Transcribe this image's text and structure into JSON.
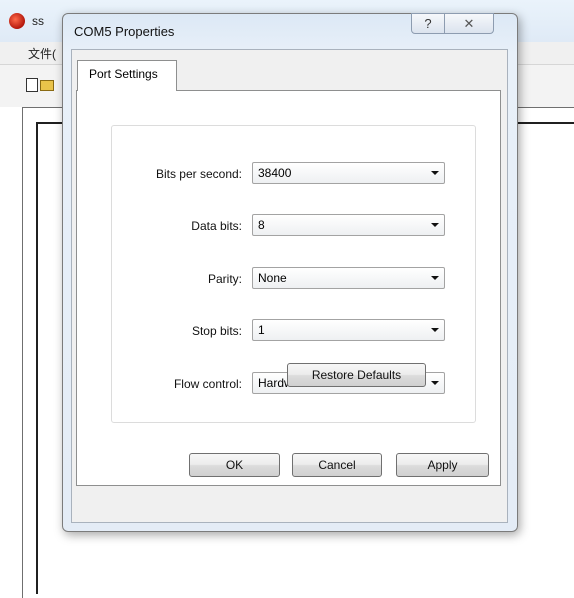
{
  "background_app": {
    "title": "ss",
    "menu_file": "文件("
  },
  "dialog": {
    "title": "COM5 Properties",
    "help_glyph": "?",
    "close_glyph": "✕",
    "tab_label": "Port Settings",
    "fields": [
      {
        "label": "Bits per second:",
        "value": "38400"
      },
      {
        "label": "Data bits:",
        "value": "8"
      },
      {
        "label": "Parity:",
        "value": "None"
      },
      {
        "label": "Stop bits:",
        "value": "1"
      },
      {
        "label": "Flow control:",
        "value": "Hardware"
      }
    ],
    "restore_defaults_label": "Restore Defaults",
    "ok_label": "OK",
    "cancel_label": "Cancel",
    "apply_label": "Apply"
  },
  "icons": {
    "app": "app-icon",
    "new_file": "new-file-icon",
    "open_folder": "open-folder-icon",
    "dropdown": "chevron-down-icon"
  }
}
